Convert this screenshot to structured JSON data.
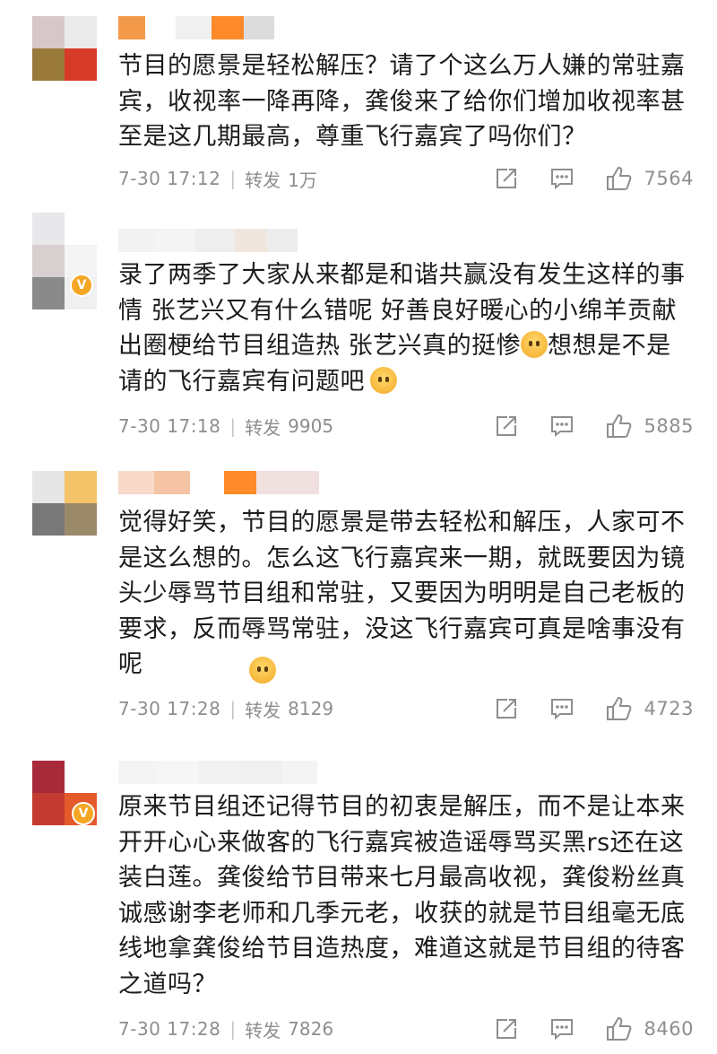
{
  "comments": [
    {
      "avatar_colors": [
        "#d8c7c9",
        "#eaeaea",
        "#9a7a3a",
        "#d83a2a"
      ],
      "badge": "",
      "name_colors": [
        "#f39a4a",
        "#ffffff",
        "#f0f0f0",
        "#ff8a2a",
        "#dcdcdc"
      ],
      "text": "节目的愿景是轻松解压？请了个这么万人嫌的常驻嘉宾，收视率一降再降，龚俊来了给你们增加收视率甚至是这几期最高，尊重飞行嘉宾了吗你们？",
      "time": "7-30 17:12",
      "repost_label": "转发",
      "repost_count": "1万",
      "like_count": "7564"
    },
    {
      "avatar_colors": [
        "#e8e8ea",
        "#f6f4f4",
        "#d8d0d0",
        "#8a8a8a"
      ],
      "badge": "V",
      "name_colors": [
        "#f2f2f2",
        "#f4f4f4",
        "#eeeeee",
        "#f0e6dd",
        "#ececec"
      ],
      "text_parts": [
        "录了两季了大家从来都是和谐共赢没有发生这样的事情 张艺兴又有什么错呢 好善良好暖心的小绵羊贡献出圈梗给节目组造热 张艺兴真的挺惨",
        "想想是不是请的飞行嘉宾有问题吧"
      ],
      "time": "7-30 17:18",
      "repost_label": "转发",
      "repost_count": "9905",
      "like_count": "5885"
    },
    {
      "avatar_colors": [
        "#e6e6e6",
        "#f4c36a",
        "#787878",
        "#9a8a6a"
      ],
      "badge": "",
      "name_colors": [
        "#f8d8c8",
        "#f4c4a4",
        "#ffffff",
        "#ff8a2a",
        "#f0e0e0"
      ],
      "text": "觉得好笑，节目的愿景是带去轻松和解压，人家可不是这么想的。怎么这飞行嘉宾来一期，就既要因为镜头少辱骂节目组和常驻，又要因为明明是自己老板的要求，反而辱骂常驻，没这飞行嘉宾可真是啥事没有呢",
      "time": "7-30 17:28",
      "repost_label": "转发",
      "repost_count": "8129",
      "like_count": "4723"
    },
    {
      "avatar_colors": [
        "#a82a3a",
        "#ffffff",
        "#c23a30",
        "#e45a2a"
      ],
      "badge": "V",
      "name_colors": [
        "#f4f4f4",
        "#f6f6f6",
        "#f2f2f2",
        "#f0f0f0",
        "#f4f4f4"
      ],
      "text": "原来节目组还记得节目的初衷是解压，而不是让本来开开心心来做客的飞行嘉宾被造谣辱骂买黑rs还在这装白莲。龚俊给节目带来七月最高收视，龚俊粉丝真诚感谢李老师和几季元老，收获的就是节目组毫无底线地拿龚俊给节目造热度，难道这就是节目组的待客之道吗？",
      "time": "7-30 17:28",
      "repost_label": "转发",
      "repost_count": "7826",
      "like_count": "8460"
    }
  ],
  "icons": {
    "share": "share-icon",
    "comment": "comment-icon",
    "like": "thumbs-up-icon",
    "emoji": "face-emoji-icon",
    "verified": "verified-badge-icon"
  },
  "colors": {
    "meta_text": "#8e8e8e",
    "body_text": "#1c1c1c",
    "badge_gold": "#f5a623"
  }
}
